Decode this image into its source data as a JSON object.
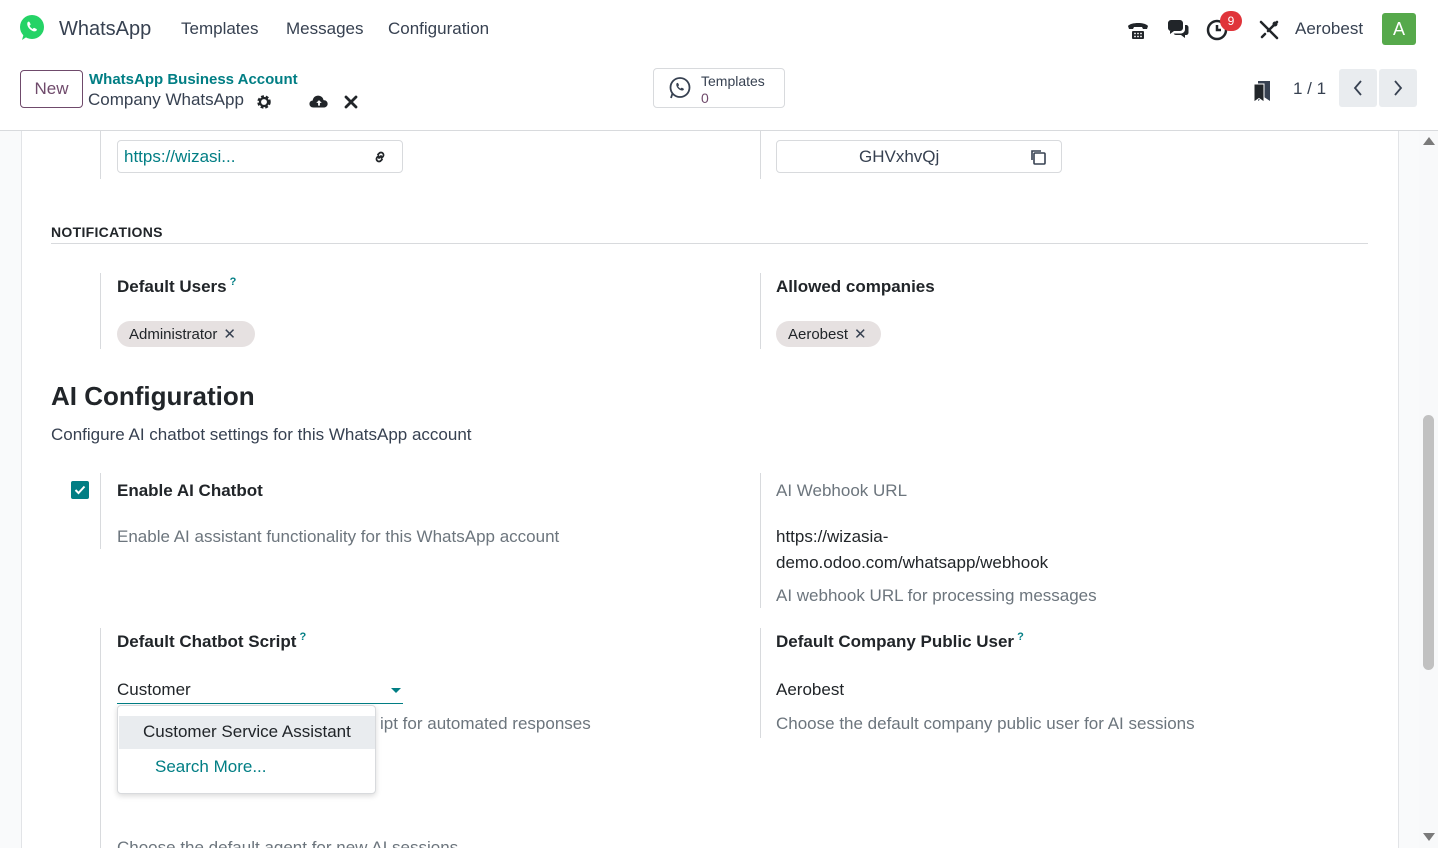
{
  "navbar": {
    "app_name": "WhatsApp",
    "menu": [
      "Templates",
      "Messages",
      "Configuration"
    ],
    "activity_badge": "9",
    "company": "Aerobest",
    "avatar_letter": "A",
    "brand_color": "#25d366"
  },
  "control_panel": {
    "new_label": "New",
    "breadcrumb_parent": "WhatsApp Business Account",
    "breadcrumb_current": "Company WhatsApp",
    "smart_button": {
      "label": "Templates",
      "value": "0"
    },
    "pager": "1 / 1"
  },
  "top_fields": {
    "callback_url": "https://wizasi...",
    "verify_token": "GHVxhvQj"
  },
  "notifications": {
    "title": "NOTIFICATIONS",
    "default_users_label": "Default Users",
    "default_users_tags": [
      "Administrator"
    ],
    "allowed_companies_label": "Allowed companies",
    "allowed_companies_tags": [
      "Aerobest"
    ],
    "help_mark": "?"
  },
  "ai_config": {
    "title": "AI Configuration",
    "subtitle": "Configure AI chatbot settings for this WhatsApp account",
    "enable_label": "Enable AI Chatbot",
    "enable_checked": true,
    "enable_help": "Enable AI assistant functionality for this WhatsApp account",
    "webhook_label": "AI Webhook URL",
    "webhook_value_line1": "https://wizasia-",
    "webhook_value_line2": "demo.odoo.com/whatsapp/webhook",
    "webhook_help": "AI webhook URL for processing messages",
    "script_label": "Default Chatbot Script",
    "script_value": "Customer",
    "script_help_partial": "ipt for automated responses",
    "public_user_label": "Default Company Public User",
    "public_user_value": "Aerobest",
    "public_user_help": "Choose the default company public user for AI sessions",
    "dropdown": {
      "option": "Customer Service Assistant",
      "search_more": "Search More..."
    },
    "cutoff_text": "Choose the default agent for new AI sessions"
  },
  "colors": {
    "accent": "#017e84",
    "primary": "#6f4a6b",
    "badge": "#e0343a",
    "avatar": "#56a94b"
  }
}
